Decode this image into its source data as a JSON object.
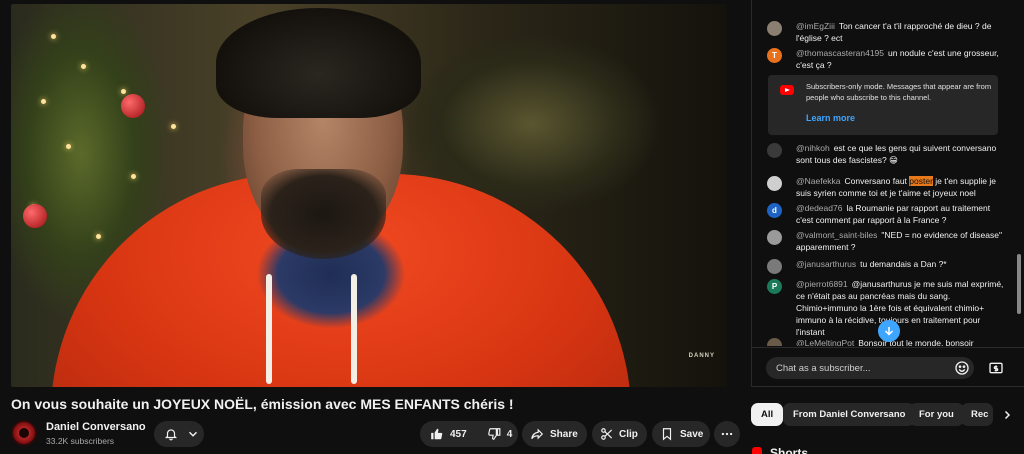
{
  "video": {
    "watermark": "DANNY",
    "title": "On vous souhaite un JOYEUX NOËL, émission avec MES ENFANTS chéris !"
  },
  "channel": {
    "name": "Daniel Conversano",
    "subscribers": "33.2K subscribers"
  },
  "actions": {
    "like_count": "457",
    "dislike_count": "4",
    "share_label": "Share",
    "clip_label": "Clip",
    "save_label": "Save"
  },
  "chat": {
    "messages": [
      {
        "user": "@imEgZiii",
        "text": "Ton cancer t'a t'il rapproché de dieu ? de l'église ? ect",
        "avatar_color": "#8a7f70"
      },
      {
        "user": "@thomascasteran4195",
        "text": "un nodule c'est une grosseur, c'est ça ?",
        "avatar_letter": "T",
        "avatar_color": "#e8711c"
      },
      {
        "user": "@nihkoh",
        "text": "est ce que les gens qui suivent conversano sont tous des fascistes?",
        "avatar_color": "#3a3a3a"
      },
      {
        "user": "@Naefekka",
        "text_before": "Conversano faut",
        "highlight": "poster",
        "text_after": "je t'en supplie je suis syrien comme toi et je t'aime et joyeux noel",
        "avatar_color": "#cfcfcf"
      },
      {
        "user": "@dedead76",
        "text": "la Roumanie par rapport au traitement c'est comment par rapport à la France ?",
        "avatar_letter": "d",
        "avatar_color": "#1e63c4"
      },
      {
        "user": "@valmont_saint-biles",
        "text": "\"NED = no evidence of disease\" apparemment ?",
        "avatar_color": "#9a9a9a"
      },
      {
        "user": "@janusarthurus",
        "text": "tu demandais a Dan ?*",
        "avatar_color": "#7a7a7a"
      },
      {
        "user": "@pierrot6891",
        "text": "@janusarthurus je me suis mal exprimé, ce n'était pas au pancréas mais du sang. Chimio+immuno la 1ère fois et équivalent chimio+ immuno à la récidive, toujours en traitement pour l'instant",
        "avatar_letter": "P",
        "avatar_color": "#1b7a5a"
      },
      {
        "user": "@LeMeltingPot",
        "text": "Bonsoir tout le monde, bonsoir",
        "avatar_color": "#6a5a4a"
      }
    ],
    "notice_text": "Subscribers-only mode. Messages that appear are from people who subscribe to this channel.",
    "learn_more": "Learn more",
    "input_placeholder": "Chat as a subscriber..."
  },
  "chips": [
    "All",
    "From Daniel Conversano",
    "For you",
    "Rec"
  ],
  "shorts_label": "Shorts",
  "colors": {
    "accent": "#3ea6ff",
    "background": "#0f0f0f",
    "surface": "#272727",
    "brand_red": "#ff0000"
  }
}
